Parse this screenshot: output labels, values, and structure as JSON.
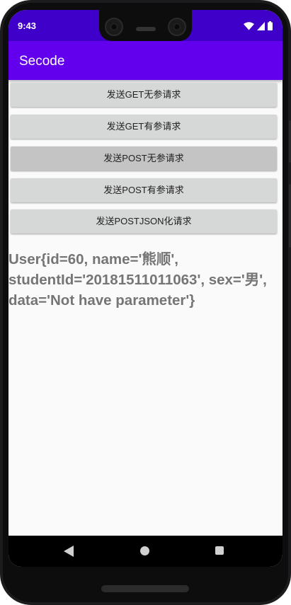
{
  "status": {
    "time": "9:43"
  },
  "app": {
    "title": "Secode"
  },
  "buttons": [
    {
      "label": "发送GET无参请求"
    },
    {
      "label": "发送GET有参请求"
    },
    {
      "label": "发送POST无参请求"
    },
    {
      "label": "发送POST有参请求"
    },
    {
      "label": "发送POSTJSON化请求"
    }
  ],
  "result": {
    "text": "User{id=60, name='熊顺', studentId='20181511011063', sex='男', data='Not have parameter'}"
  },
  "colors": {
    "status_bar": "#3f00c9",
    "app_bar": "#6200ee",
    "button": "#d6d7d7",
    "result_text": "#757575"
  },
  "icons": [
    "wifi-icon",
    "signal-icon",
    "battery-icon",
    "back-icon",
    "home-icon",
    "recents-icon"
  ]
}
